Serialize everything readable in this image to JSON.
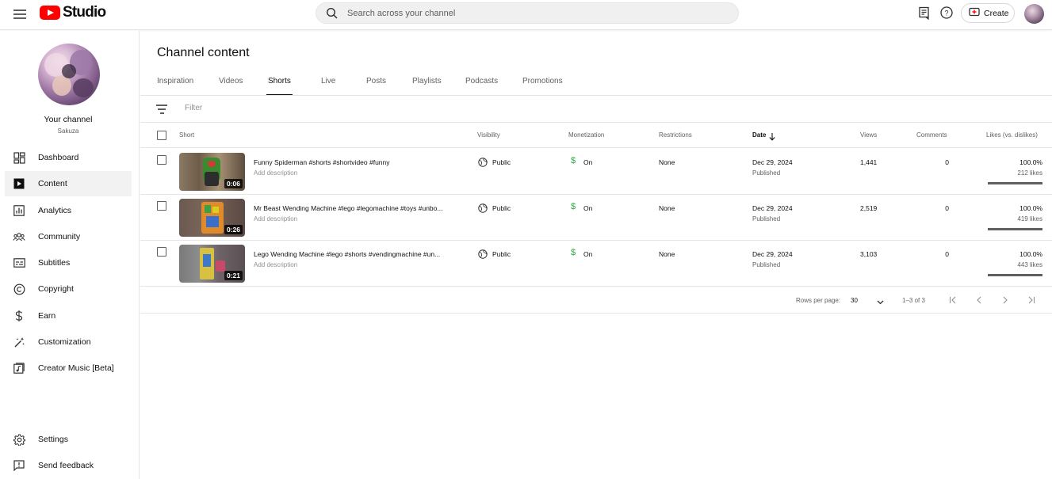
{
  "header": {
    "logo_text": "Studio",
    "search_placeholder": "Search across your channel",
    "create_label": "Create"
  },
  "sidebar": {
    "channel_name": "Your channel",
    "channel_handle": "Sakuza",
    "items": [
      {
        "label": "Dashboard",
        "icon": "dashboard-icon"
      },
      {
        "label": "Content",
        "icon": "content-icon",
        "active": true
      },
      {
        "label": "Analytics",
        "icon": "analytics-icon"
      },
      {
        "label": "Community",
        "icon": "community-icon"
      },
      {
        "label": "Subtitles",
        "icon": "subtitles-icon"
      },
      {
        "label": "Copyright",
        "icon": "copyright-icon"
      },
      {
        "label": "Earn",
        "icon": "earn-icon"
      },
      {
        "label": "Customization",
        "icon": "customization-icon"
      },
      {
        "label": "Creator Music [Beta]",
        "icon": "creator-music-icon"
      }
    ],
    "bottom_items": [
      {
        "label": "Settings",
        "icon": "settings-icon"
      },
      {
        "label": "Send feedback",
        "icon": "feedback-icon"
      }
    ]
  },
  "main": {
    "title": "Channel content",
    "tabs": [
      {
        "label": "Inspiration"
      },
      {
        "label": "Videos"
      },
      {
        "label": "Shorts",
        "active": true
      },
      {
        "label": "Live"
      },
      {
        "label": "Posts"
      },
      {
        "label": "Playlists"
      },
      {
        "label": "Podcasts"
      },
      {
        "label": "Promotions"
      }
    ],
    "filter_placeholder": "Filter",
    "columns": {
      "short": "Short",
      "visibility": "Visibility",
      "monetization": "Monetization",
      "restrictions": "Restrictions",
      "date": "Date",
      "views": "Views",
      "comments": "Comments",
      "likes": "Likes (vs. dislikes)"
    },
    "rows": [
      {
        "title": "Funny Spiderman #shorts #shortvideo #funny",
        "description": "Add description",
        "duration": "0:06",
        "visibility": "Public",
        "monetization": "On",
        "restrictions": "None",
        "date": "Dec 29, 2024",
        "date_status": "Published",
        "views": "1,441",
        "comments": "0",
        "likes_pct": "100.0%",
        "likes_count": "212 likes"
      },
      {
        "title": "Mr Beast Wending Machine #lego #legomachine #toys #unbo...",
        "description": "Add description",
        "duration": "0:26",
        "visibility": "Public",
        "monetization": "On",
        "restrictions": "None",
        "date": "Dec 29, 2024",
        "date_status": "Published",
        "views": "2,519",
        "comments": "0",
        "likes_pct": "100.0%",
        "likes_count": "419 likes"
      },
      {
        "title": "Lego Wending Machine #lego #shorts #vendingmachine #un...",
        "description": "Add description",
        "duration": "0:21",
        "visibility": "Public",
        "monetization": "On",
        "restrictions": "None",
        "date": "Dec 29, 2024",
        "date_status": "Published",
        "views": "3,103",
        "comments": "0",
        "likes_pct": "100.0%",
        "likes_count": "443 likes"
      }
    ],
    "pagination": {
      "rows_per_page_label": "Rows per page:",
      "rows_per_page_value": "30",
      "range": "1–3 of 3"
    }
  },
  "colors": {
    "brand_red": "#ff0000",
    "monetization_green": "#2ba640",
    "text_primary": "#0f0f0f",
    "text_secondary": "#606060"
  }
}
